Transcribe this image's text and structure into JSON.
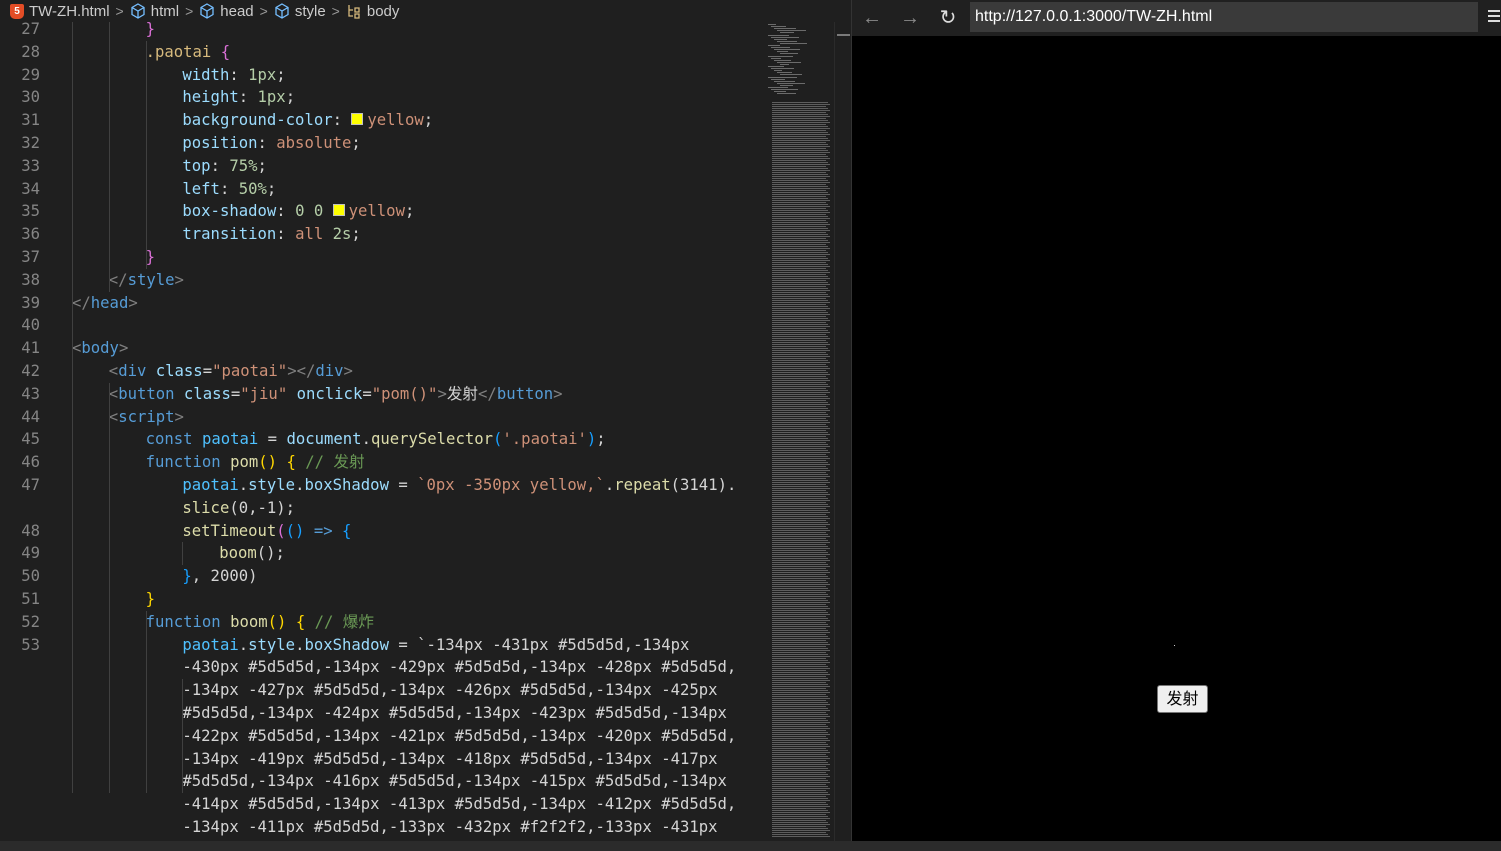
{
  "breadcrumb": {
    "file": "TW-ZH.html",
    "html": "html",
    "head": "head",
    "style": "style",
    "body": "body"
  },
  "editor": {
    "lines": [
      {
        "n": "27",
        "indent": 2,
        "segs": [
          [
            "t-br2",
            "}"
          ]
        ]
      },
      {
        "n": "28",
        "indent": 2,
        "segs": [
          [
            "t-sel",
            ".paotai"
          ],
          [
            "t-pl",
            " "
          ],
          [
            "t-br2",
            "{"
          ]
        ]
      },
      {
        "n": "29",
        "indent": 3,
        "segs": [
          [
            "t-prop",
            "width"
          ],
          [
            "t-pl",
            ": "
          ],
          [
            "t-num",
            "1px"
          ],
          [
            "t-pl",
            ";"
          ]
        ]
      },
      {
        "n": "30",
        "indent": 3,
        "segs": [
          [
            "t-prop",
            "height"
          ],
          [
            "t-pl",
            ": "
          ],
          [
            "t-num",
            "1px"
          ],
          [
            "t-pl",
            ";"
          ]
        ]
      },
      {
        "n": "31",
        "indent": 3,
        "segs": [
          [
            "t-prop",
            "background-color"
          ],
          [
            "t-pl",
            ": "
          ],
          [
            "swatch",
            ""
          ],
          [
            "t-val",
            "yellow"
          ],
          [
            "t-pl",
            ";"
          ]
        ]
      },
      {
        "n": "32",
        "indent": 3,
        "segs": [
          [
            "t-prop",
            "position"
          ],
          [
            "t-pl",
            ": "
          ],
          [
            "t-val",
            "absolute"
          ],
          [
            "t-pl",
            ";"
          ]
        ]
      },
      {
        "n": "33",
        "indent": 3,
        "segs": [
          [
            "t-prop",
            "top"
          ],
          [
            "t-pl",
            ": "
          ],
          [
            "t-num",
            "75%"
          ],
          [
            "t-pl",
            ";"
          ]
        ]
      },
      {
        "n": "34",
        "indent": 3,
        "segs": [
          [
            "t-prop",
            "left"
          ],
          [
            "t-pl",
            ": "
          ],
          [
            "t-num",
            "50%"
          ],
          [
            "t-pl",
            ";"
          ]
        ]
      },
      {
        "n": "35",
        "indent": 3,
        "segs": [
          [
            "t-prop",
            "box-shadow"
          ],
          [
            "t-pl",
            ": "
          ],
          [
            "t-num",
            "0 0 "
          ],
          [
            "swatch",
            ""
          ],
          [
            "t-val",
            "yellow"
          ],
          [
            "t-pl",
            ";"
          ]
        ]
      },
      {
        "n": "36",
        "indent": 3,
        "segs": [
          [
            "t-prop",
            "transition"
          ],
          [
            "t-pl",
            ": "
          ],
          [
            "t-val",
            "all "
          ],
          [
            "t-num",
            "2s"
          ],
          [
            "t-pl",
            ";"
          ]
        ]
      },
      {
        "n": "37",
        "indent": 2,
        "segs": [
          [
            "t-br2",
            "}"
          ]
        ]
      },
      {
        "n": "38",
        "indent": 1,
        "segs": [
          [
            "t-tag",
            "</"
          ],
          [
            "t-el",
            "style"
          ],
          [
            "t-tag",
            ">"
          ]
        ]
      },
      {
        "n": "39",
        "indent": 0,
        "segs": [
          [
            "t-tag",
            "</"
          ],
          [
            "t-el",
            "head"
          ],
          [
            "t-tag",
            ">"
          ]
        ]
      },
      {
        "n": "40",
        "indent": 0,
        "segs": []
      },
      {
        "n": "41",
        "indent": 0,
        "segs": [
          [
            "t-tag",
            "<"
          ],
          [
            "t-el",
            "body"
          ],
          [
            "t-tag",
            ">"
          ]
        ]
      },
      {
        "n": "42",
        "indent": 1,
        "segs": [
          [
            "t-tag",
            "<"
          ],
          [
            "t-el",
            "div"
          ],
          [
            "t-pl",
            " "
          ],
          [
            "t-attr",
            "class"
          ],
          [
            "t-pl",
            "="
          ],
          [
            "t-str",
            "\"paotai\""
          ],
          [
            "t-tag",
            "></"
          ],
          [
            "t-el",
            "div"
          ],
          [
            "t-tag",
            ">"
          ]
        ]
      },
      {
        "n": "43",
        "indent": 1,
        "segs": [
          [
            "t-tag",
            "<"
          ],
          [
            "t-el",
            "button"
          ],
          [
            "t-pl",
            " "
          ],
          [
            "t-attr",
            "class"
          ],
          [
            "t-pl",
            "="
          ],
          [
            "t-str",
            "\"jiu\""
          ],
          [
            "t-pl",
            " "
          ],
          [
            "t-attr",
            "onclick"
          ],
          [
            "t-pl",
            "="
          ],
          [
            "t-str",
            "\"pom()\""
          ],
          [
            "t-tag",
            ">"
          ],
          [
            "t-pl",
            "发射"
          ],
          [
            "t-tag",
            "</"
          ],
          [
            "t-el",
            "button"
          ],
          [
            "t-tag",
            ">"
          ]
        ]
      },
      {
        "n": "44",
        "indent": 1,
        "segs": [
          [
            "t-tag",
            "<"
          ],
          [
            "t-el",
            "script"
          ],
          [
            "t-tag",
            ">"
          ]
        ]
      },
      {
        "n": "45",
        "indent": 2,
        "segs": [
          [
            "t-kw",
            "const"
          ],
          [
            "t-pl",
            " "
          ],
          [
            "t-var",
            "paotai"
          ],
          [
            "t-pl",
            " = "
          ],
          [
            "t-vr",
            "document"
          ],
          [
            "t-pl",
            "."
          ],
          [
            "t-fn",
            "querySelector"
          ],
          [
            "t-br3",
            "("
          ],
          [
            "t-str",
            "'.paotai'"
          ],
          [
            "t-br3",
            ")"
          ],
          [
            "t-pl",
            ";"
          ]
        ]
      },
      {
        "n": "46",
        "indent": 2,
        "segs": [
          [
            "t-kw",
            "function"
          ],
          [
            "t-pl",
            " "
          ],
          [
            "t-fn",
            "pom"
          ],
          [
            "t-br1",
            "()"
          ],
          [
            "t-pl",
            " "
          ],
          [
            "t-br1",
            "{"
          ],
          [
            "t-pl",
            " "
          ],
          [
            "t-cm",
            "// 发射"
          ]
        ]
      },
      {
        "n": "47",
        "indent": 3,
        "segs": [
          [
            "t-var",
            "paotai"
          ],
          [
            "t-pl",
            "."
          ],
          [
            "t-vr",
            "style"
          ],
          [
            "t-pl",
            "."
          ],
          [
            "t-vr",
            "boxShadow"
          ],
          [
            "t-pl",
            " = "
          ],
          [
            "t-str",
            "`0px -350px yellow,`"
          ],
          [
            "t-pl",
            "."
          ],
          [
            "t-fn",
            "repeat"
          ],
          [
            "t-pl",
            "(3141)."
          ]
        ]
      },
      {
        "n": "",
        "indent": 3,
        "segs": [
          [
            "t-fn",
            "slice"
          ],
          [
            "t-pl",
            "(0,-1);"
          ]
        ]
      },
      {
        "n": "48",
        "indent": 3,
        "segs": [
          [
            "t-fn",
            "setTimeout"
          ],
          [
            "t-br2",
            "("
          ],
          [
            "t-br3",
            "()"
          ],
          [
            "t-pl",
            " "
          ],
          [
            "t-kw",
            "=>"
          ],
          [
            "t-pl",
            " "
          ],
          [
            "t-br3",
            "{"
          ]
        ]
      },
      {
        "n": "49",
        "indent": 4,
        "segs": [
          [
            "t-fn",
            "boom"
          ],
          [
            "t-pl",
            "();"
          ]
        ]
      },
      {
        "n": "50",
        "indent": 3,
        "segs": [
          [
            "t-br3",
            "}"
          ],
          [
            "t-pl",
            ", 2000)"
          ]
        ]
      },
      {
        "n": "51",
        "indent": 2,
        "segs": [
          [
            "t-br1",
            "}"
          ]
        ]
      },
      {
        "n": "52",
        "indent": 2,
        "segs": [
          [
            "t-kw",
            "function"
          ],
          [
            "t-pl",
            " "
          ],
          [
            "t-fn",
            "boom"
          ],
          [
            "t-br1",
            "()"
          ],
          [
            "t-pl",
            " "
          ],
          [
            "t-br1",
            "{"
          ],
          [
            "t-pl",
            " "
          ],
          [
            "t-cm",
            "// 爆炸"
          ]
        ]
      },
      {
        "n": "53",
        "indent": 3,
        "segs": [
          [
            "t-var",
            "paotai"
          ],
          [
            "t-pl",
            "."
          ],
          [
            "t-vr",
            "style"
          ],
          [
            "t-pl",
            "."
          ],
          [
            "t-vr",
            "boxShadow"
          ],
          [
            "t-pl",
            " = `-134px -431px #5d5d5d,-134px"
          ]
        ]
      },
      {
        "n": "",
        "indent": 3,
        "segs": [
          [
            "t-pl",
            "-430px #5d5d5d,-134px -429px #5d5d5d,-134px -428px #5d5d5d,"
          ]
        ]
      },
      {
        "n": "",
        "indent": 3,
        "segs": [
          [
            "t-pl",
            "-134px -427px #5d5d5d,-134px -426px #5d5d5d,-134px -425px"
          ]
        ]
      },
      {
        "n": "",
        "indent": 3,
        "segs": [
          [
            "t-pl",
            "#5d5d5d,-134px -424px #5d5d5d,-134px -423px #5d5d5d,-134px"
          ]
        ]
      },
      {
        "n": "",
        "indent": 3,
        "segs": [
          [
            "t-pl",
            "-422px #5d5d5d,-134px -421px #5d5d5d,-134px -420px #5d5d5d,"
          ]
        ]
      },
      {
        "n": "",
        "indent": 3,
        "segs": [
          [
            "t-pl",
            "-134px -419px #5d5d5d,-134px -418px #5d5d5d,-134px -417px"
          ]
        ]
      },
      {
        "n": "",
        "indent": 3,
        "segs": [
          [
            "t-pl",
            "#5d5d5d,-134px -416px #5d5d5d,-134px -415px #5d5d5d,-134px"
          ]
        ]
      },
      {
        "n": "",
        "indent": 3,
        "segs": [
          [
            "t-pl",
            "-414px #5d5d5d,-134px -413px #5d5d5d,-134px -412px #5d5d5d,"
          ]
        ]
      },
      {
        "n": "",
        "indent": 3,
        "segs": [
          [
            "t-pl",
            "-134px -411px #5d5d5d,-133px -432px #f2f2f2,-133px -431px"
          ]
        ]
      }
    ]
  },
  "browser": {
    "url": "http://127.0.0.1:3000/TW-ZH.html",
    "back_icon": "back-arrow-icon",
    "forward_icon": "forward-arrow-icon",
    "reload_icon": "reload-icon",
    "menu_icon": "hamburger-menu-icon",
    "button_label": "发射"
  },
  "colors": {
    "editor_bg": "#1f1f1f",
    "swatch_yellow": "#ffff00",
    "page_bg": "#000000"
  }
}
